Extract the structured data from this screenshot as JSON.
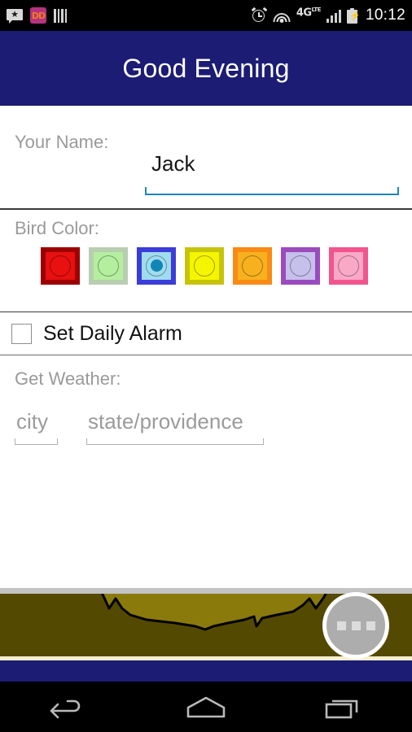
{
  "statusbar": {
    "time": "10:12",
    "network_label": "4G",
    "network_sup": "LTE",
    "dd_label": "DD",
    "left_icons": [
      "message-star-icon",
      "dunkin-donuts-icon",
      "barcode-icon"
    ],
    "right_icons": [
      "alarm-icon",
      "wifi-icon",
      "4glte-icon",
      "signal-icon",
      "battery-charging-icon"
    ]
  },
  "header": {
    "title": "Good Evening",
    "background": "#1c1c74"
  },
  "form": {
    "name": {
      "label": "Your Name:",
      "value": "Jack",
      "placeholder": "Your Name",
      "underline_color": "#1d87bf"
    },
    "bird_color": {
      "label": "Bird Color:",
      "selected_index": 2,
      "selected_dot_color": "#1186b5",
      "swatches": [
        {
          "name": "red",
          "border": "#9c0000",
          "fill": "#e81010"
        },
        {
          "name": "green",
          "border": "#b9cdb0",
          "fill": "#b4efa0"
        },
        {
          "name": "blue",
          "border": "#3c3cd8",
          "fill": "#9fdcef"
        },
        {
          "name": "yellow",
          "border": "#c6c40a",
          "fill": "#f5f500"
        },
        {
          "name": "orange",
          "border": "#f98a14",
          "fill": "#f7b11f"
        },
        {
          "name": "purple",
          "border": "#9b4bbd",
          "fill": "#c6c0ec"
        },
        {
          "name": "pink",
          "border": "#f2548e",
          "fill": "#f9a9c6"
        }
      ]
    },
    "alarm": {
      "label": "Set Daily Alarm",
      "checked": false
    },
    "weather": {
      "label": "Get Weather:",
      "city_placeholder": "city",
      "city_value": "",
      "state_placeholder": "state/providence",
      "state_value": ""
    },
    "save_button": {
      "name": "save-button",
      "icon": "floppy-disk-icon",
      "color": "#f90606"
    }
  },
  "bottom": {
    "band_color": "#544900",
    "bird_color": "#8a7a0c",
    "more_button_icon": "overflow-dots-icon"
  },
  "navbar": {
    "back": "back-icon",
    "home": "home-icon",
    "recents": "recents-icon"
  }
}
